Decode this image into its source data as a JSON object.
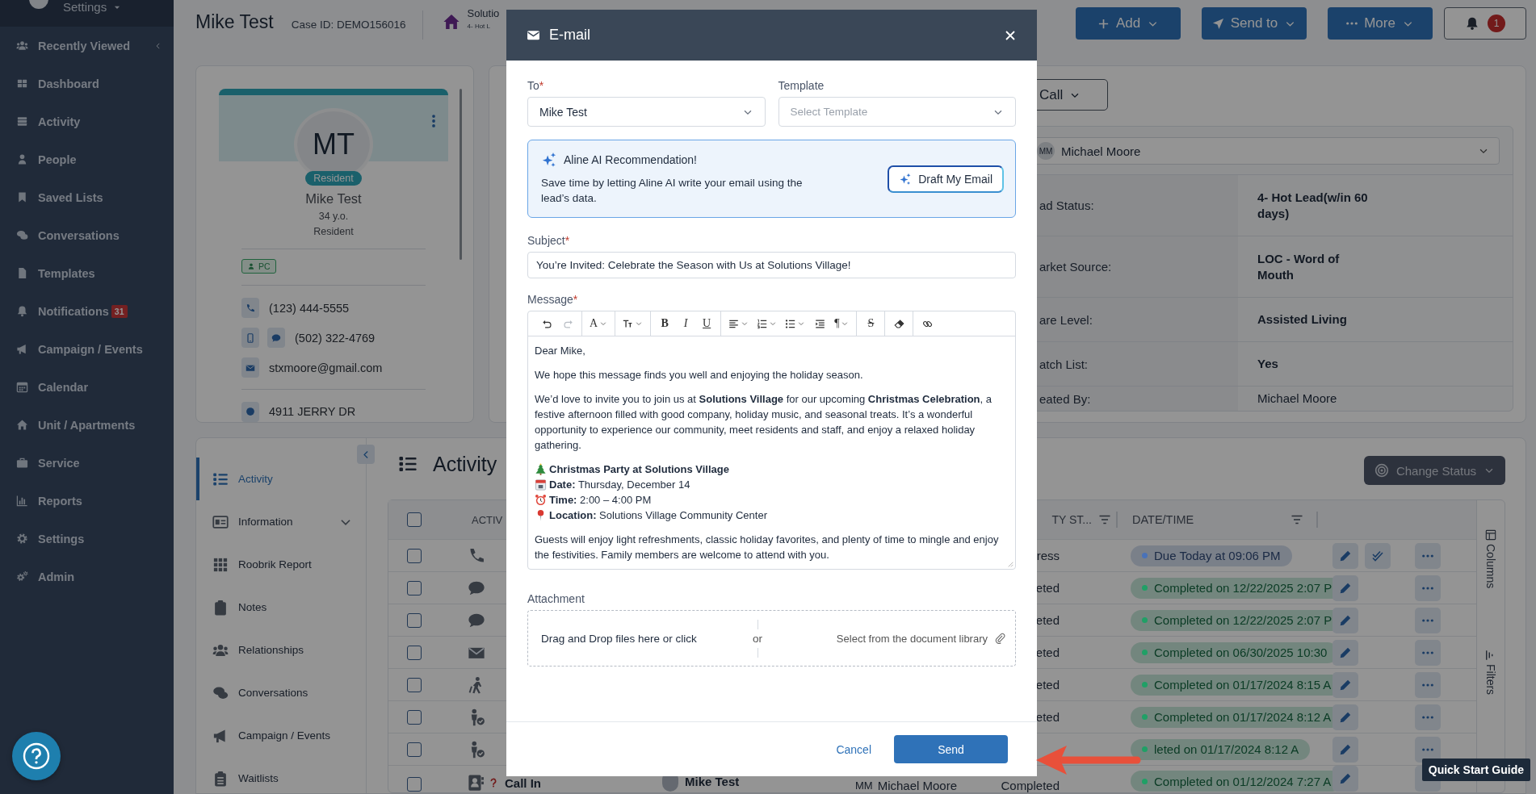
{
  "sidebar": {
    "user_menu": "Settings",
    "items": [
      {
        "label": "Recently Viewed",
        "chevron": true
      },
      {
        "label": "Dashboard",
        "chevron": false
      },
      {
        "label": "Activity",
        "chevron": false
      },
      {
        "label": "People",
        "chevron": false
      },
      {
        "label": "Saved Lists",
        "chevron": false
      },
      {
        "label": "Conversations",
        "chevron": false
      },
      {
        "label": "Templates",
        "chevron": false
      },
      {
        "label": "Notifications",
        "chevron": false,
        "badge": "31"
      },
      {
        "label": "Campaign / Events",
        "chevron": false
      },
      {
        "label": "Calendar",
        "chevron": false
      },
      {
        "label": "Unit / Apartments",
        "chevron": false
      },
      {
        "label": "Service",
        "chevron": false
      },
      {
        "label": "Reports",
        "chevron": false
      },
      {
        "label": "Settings",
        "chevron": false
      },
      {
        "label": "Admin",
        "chevron": false
      }
    ]
  },
  "header": {
    "name": "Mike Test",
    "case_id": "Case ID: DEMO156016",
    "community": "Solutio",
    "community_status": "4- Hot L",
    "buttons": [
      {
        "label": "Add"
      },
      {
        "label": "Send to"
      },
      {
        "label": "More"
      }
    ],
    "notifications": "1"
  },
  "profile": {
    "initials": "MT",
    "badge": "Resident",
    "name": "Mike Test",
    "age": "34 y.o.",
    "role": "Resident",
    "tag": "PC",
    "phone": "(123) 444-5555",
    "mobile": "(502) 322-4769",
    "email": "stxmoore@gmail.com",
    "address": "4911 JERRY DR"
  },
  "details": {
    "call_button": "Call",
    "owner_initials": "MM",
    "owner": "Michael Moore",
    "fields": [
      {
        "label": "ad Status:",
        "value": "4- Hot Lead(w/in 60 days)",
        "bold": true
      },
      {
        "label": "arket Source:",
        "value": "LOC - Word of Mouth",
        "bold": true
      },
      {
        "label": "are Level:",
        "value": "Assisted Living",
        "bold": true
      },
      {
        "label": "atch List:",
        "value": "Yes",
        "bold": true
      },
      {
        "label": "eated By:",
        "value": "Michael Moore",
        "bold": false
      }
    ]
  },
  "nav": [
    {
      "label": "Activity",
      "selected": true
    },
    {
      "label": "Information",
      "selected": false,
      "expanded": false
    },
    {
      "label": "Roobrik Report",
      "selected": false
    },
    {
      "label": "Notes",
      "selected": false
    },
    {
      "label": "Relationships",
      "selected": false
    },
    {
      "label": "Conversations",
      "selected": false
    },
    {
      "label": "Campaign / Events",
      "selected": false
    },
    {
      "label": "Waitlists",
      "selected": false
    }
  ],
  "activity": {
    "title": "Activity",
    "change_status": "Change Status",
    "header": {
      "checked": false,
      "activity": "ACTIV",
      "status": "TY ST...",
      "datetime": "DATE/TIME"
    },
    "columns_tab": "Columns",
    "filters_tab": "Filters",
    "rows": [
      {
        "kind": "call",
        "checked": false,
        "status": "ress",
        "datetime": "Due Today at 09:06 PM",
        "color": "#4a72b8",
        "complete_button": true
      },
      {
        "kind": "sms",
        "checked": false,
        "status": "eted",
        "datetime": "Completed on 12/22/2025 2:07 P",
        "color": "#20a066",
        "complete_button": false
      },
      {
        "kind": "sms",
        "checked": false,
        "status": "eted",
        "datetime": "Completed on 12/22/2025 2:07 P",
        "color": "#20a066",
        "complete_button": false
      },
      {
        "kind": "email",
        "checked": false,
        "status": "eted",
        "datetime": "Completed on 06/30/2025 10:30",
        "color": "#20a066",
        "complete_button": false
      },
      {
        "kind": "visit",
        "checked": false,
        "status": "eted",
        "datetime": "Completed on 01/17/2024 8:15 A",
        "color": "#20a066",
        "complete_button": false
      },
      {
        "kind": "checkin",
        "checked": false,
        "status": "eted",
        "datetime": "Completed on 01/17/2024 8:12 A",
        "color": "#20a066",
        "complete_button": false
      },
      {
        "kind": "checkin",
        "checked": false,
        "datetime": "leted on 01/17/2024 8:12 A",
        "color": "#20a066",
        "complete_button": false
      },
      {
        "kind": "contact",
        "checked": false,
        "alert": true,
        "name": "Call In",
        "contact": "Mike Test",
        "owner_initials": "MM",
        "owner": "Michael Moore",
        "status": "Completed",
        "datetime": "Completed on 01/12/2024 7:27 A",
        "color": "#20a066",
        "complete_button": false
      }
    ]
  },
  "modal": {
    "title": "E-mail",
    "to": {
      "label": "To",
      "required_mark": "*",
      "value": "Mike Test"
    },
    "template": {
      "label": "Template",
      "placeholder": "Select Template"
    },
    "ai": {
      "title": "Aline AI Recommendation!",
      "text": "Save time by letting Aline AI write your email using the lead’s data.",
      "button": "Draft My Email"
    },
    "subject": {
      "label": "Subject",
      "required_mark": "*",
      "value": "You’re Invited: Celebrate the Season with Us at Solutions Village!"
    },
    "message": {
      "label": "Message",
      "required_mark": "*",
      "toolbar": [
        [
          {
            "kind": "undo",
            "disabled": false
          },
          {
            "kind": "redo",
            "disabled": true
          }
        ],
        [
          {
            "kind": "color",
            "label": "A",
            "dropdown": true
          }
        ],
        [
          {
            "kind": "size",
            "dropdown": true
          }
        ],
        [
          {
            "kind": "bold",
            "label": "B"
          },
          {
            "kind": "italic",
            "label": "I"
          },
          {
            "kind": "underline",
            "label": "U"
          }
        ],
        [
          {
            "kind": "align",
            "dropdown": true
          },
          {
            "kind": "ordered",
            "dropdown": true
          },
          {
            "kind": "bullets",
            "dropdown": true
          },
          {
            "kind": "indent"
          },
          {
            "kind": "paragraph",
            "label": "¶",
            "dropdown": true
          }
        ],
        [
          {
            "kind": "strike",
            "label": "S"
          }
        ],
        [
          {
            "kind": "eraser"
          }
        ],
        [
          {
            "kind": "link"
          }
        ]
      ],
      "body": [
        {
          "kind": "paragraph",
          "text": "Dear Mike,"
        },
        {
          "kind": "paragraph",
          "text": "We hope this message finds you well and enjoying the holiday season."
        },
        {
          "kind": "paragraph",
          "text": "We’d love to invite you to join us at **Solutions Village** for our upcoming **Christmas Celebration**, a festive afternoon filled with good company, holiday music, and seasonal treats. It’s a wonderful opportunity to experience our community, meet residents and staff, and enjoy a relaxed holiday gathering."
        },
        {
          "kind": "details",
          "lines": [
            {
              "kind": "tree",
              "text": "**Christmas Party at Solutions Village**"
            },
            {
              "kind": "calendar",
              "text": "**Date:** Thursday, December 14"
            },
            {
              "kind": "clock",
              "text": "**Time:** 2:00 – 4:00 PM"
            },
            {
              "kind": "pin",
              "text": "**Location:** Solutions Village Community Center"
            }
          ]
        },
        {
          "kind": "paragraph",
          "text": "Guests will enjoy light refreshments, classic holiday favorites, and plenty of time to mingle and enjoy the festivities. Family members are welcome to attend with you."
        }
      ]
    },
    "attachment": {
      "label": "Attachment",
      "drop": "Drag and Drop files here or click",
      "or": "or",
      "library": "Select from the document library"
    },
    "cancel": "Cancel",
    "send": "Send"
  },
  "quick_start": "Quick Start Guide"
}
